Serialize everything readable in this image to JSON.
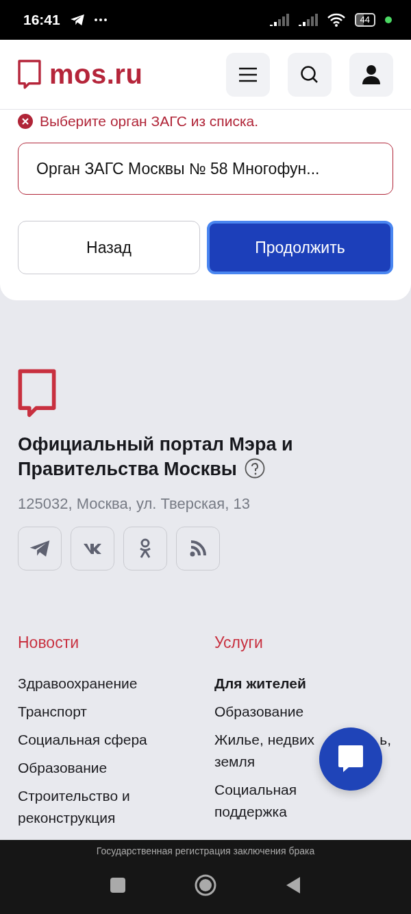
{
  "status_bar": {
    "time": "16:41",
    "battery": "44"
  },
  "header": {
    "logo": "mos.ru"
  },
  "form": {
    "error": "Выберите орган ЗАГС из списка.",
    "select": {
      "value": "Орган ЗАГС Москвы № 58 Многофун...",
      "invalid": true
    },
    "buttons": [
      {
        "label": "Назад",
        "kind": "secondary"
      },
      {
        "label": "Продолжить",
        "kind": "primary"
      }
    ]
  },
  "footer": {
    "title": "Официальный портал Мэра и Правительства Москвы",
    "address": "125032, Москва, ул. Тверская, 13",
    "columns": [
      {
        "heading": "Новости",
        "items": [
          {
            "label": "Здравоохранение",
            "kind": "link"
          },
          {
            "label": "Транспорт",
            "kind": "link"
          },
          {
            "label": "Социальная сфера",
            "kind": "link"
          },
          {
            "label": "Образование",
            "kind": "link"
          },
          {
            "label": "Строительство и реконструкция",
            "kind": "link"
          }
        ]
      },
      {
        "heading": "Услуги",
        "items": [
          {
            "label": "Для жителей",
            "kind": "category"
          },
          {
            "label": "Образование",
            "kind": "link"
          },
          {
            "label": "Жилье, недвих",
            "covered_tail": "ь,",
            "next_line": "земля",
            "kind": "covered"
          },
          {
            "label": "Социальная поддержка",
            "kind": "link"
          }
        ]
      }
    ]
  },
  "page_caption": "Государственная регистрация заключения брака"
}
